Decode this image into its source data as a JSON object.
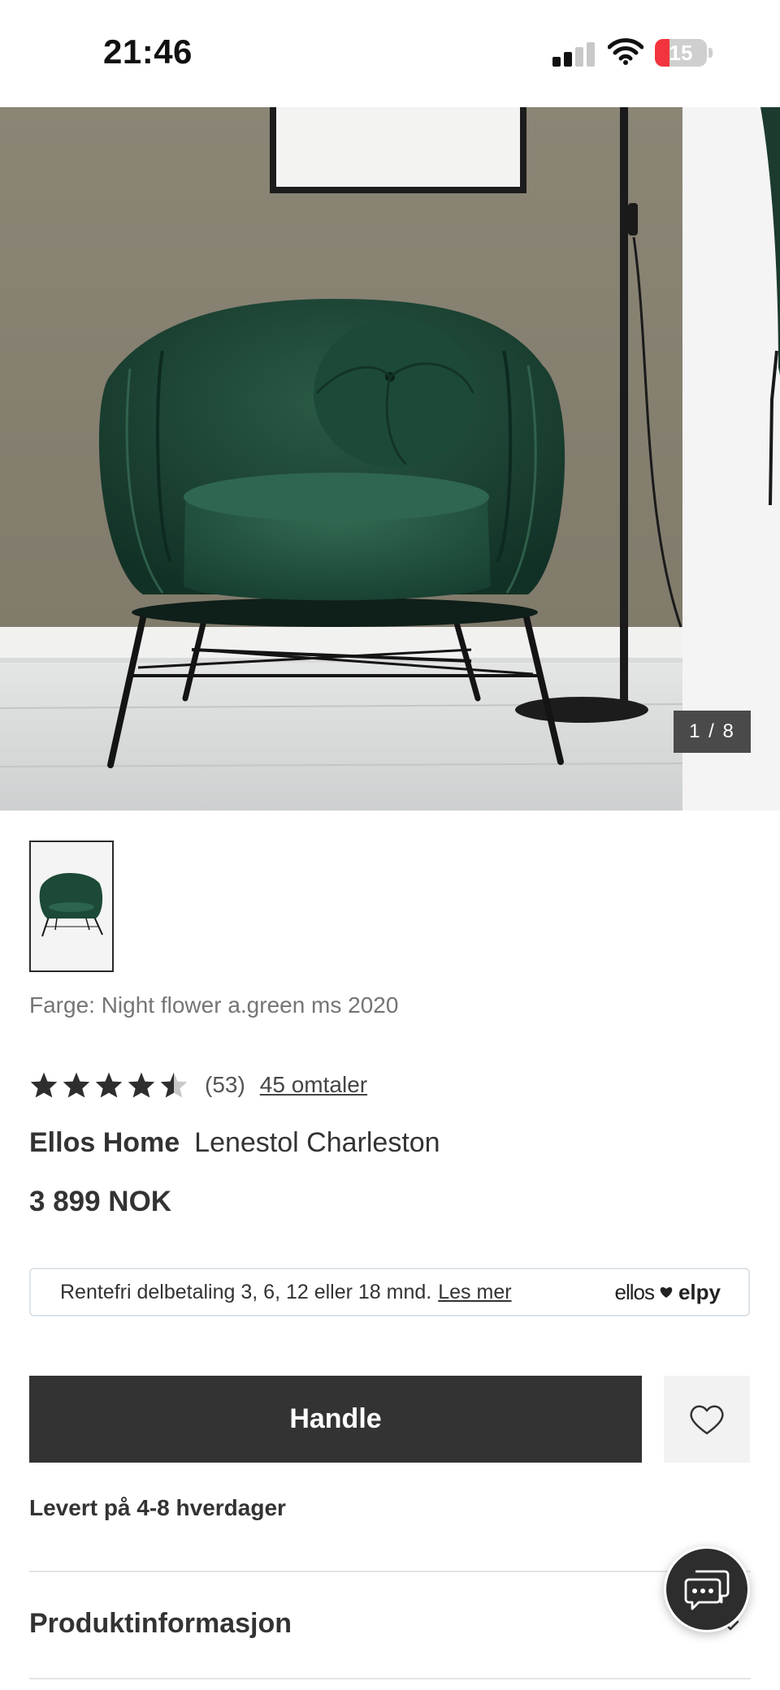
{
  "status_bar": {
    "time": "21:46",
    "battery_level": "15",
    "battery_fraction": 0.15,
    "battery_color": "#f2343e",
    "signal_bars_active": 2
  },
  "gallery": {
    "counter": "1 / 8",
    "current_index": 1,
    "total_images": 8,
    "image_subject": "dark green velvet armchair with black metal legs"
  },
  "product": {
    "color_label": "Farge: Night flower a.green ms 2020",
    "rating": 4.5,
    "rating_count": "(53)",
    "reviews_link": "45 omtaler",
    "brand": "Ellos Home",
    "name": "Lenestol Charleston",
    "price": "3 899 NOK"
  },
  "installment": {
    "text": "Rentefri delbetaling 3, 6, 12 eller 18 mnd.",
    "link": "Les mer",
    "logo_left": "ellos",
    "logo_right": "elpy"
  },
  "actions": {
    "buy_label": "Handle",
    "wishlist_icon": "heart-icon"
  },
  "delivery": "Levert på 4-8 hverdager",
  "sections": {
    "product_info": "Produktinformasjon"
  },
  "chat": {
    "icon": "chat-icon"
  },
  "colors": {
    "button_dark": "#333333",
    "chair_green": "#1f4a38",
    "wall": "#8a8473"
  }
}
